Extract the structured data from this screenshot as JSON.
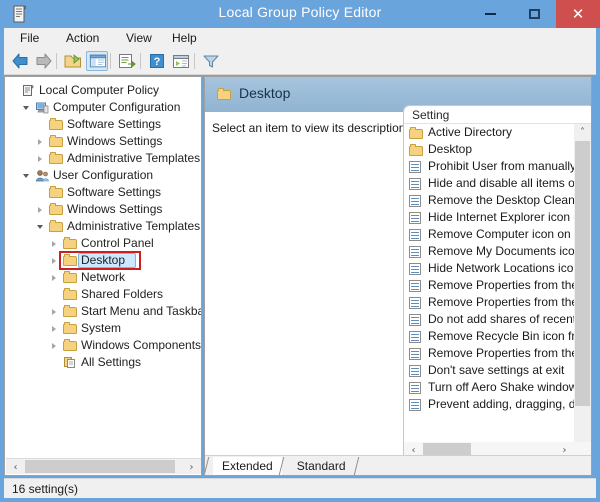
{
  "window": {
    "title": "Local Group Policy Editor",
    "icon": "policy-document-icon",
    "accent": "#6aa4dd",
    "close_color": "#cf4f4f",
    "buttons": {
      "minimize": "–",
      "maximize": "□",
      "close": "×"
    }
  },
  "menu": {
    "items": [
      "File",
      "Action",
      "View",
      "Help"
    ]
  },
  "toolbar": {
    "items": [
      {
        "name": "back-icon",
        "label": "Back"
      },
      {
        "name": "forward-icon",
        "label": "Forward"
      },
      {
        "name": "up-folder-icon",
        "label": "Up One Level"
      },
      {
        "name": "show-hide-console-tree-icon",
        "label": "Show/Hide Console Tree",
        "active": true
      },
      {
        "name": "export-list-icon",
        "label": "Export List"
      },
      {
        "name": "help-icon",
        "label": "Help"
      },
      {
        "name": "show-hide-action-pane-icon",
        "label": "Show/Hide Action Pane"
      },
      {
        "name": "filter-icon",
        "label": "Filter"
      }
    ]
  },
  "tree": {
    "nodes": [
      {
        "label": "Local Computer Policy",
        "depth": 0,
        "icon": "policy-icon",
        "twisty": "none"
      },
      {
        "label": "Computer Configuration",
        "depth": 1,
        "icon": "computer-icon",
        "twisty": "open"
      },
      {
        "label": "Software Settings",
        "depth": 2,
        "icon": "folder-icon",
        "twisty": "none"
      },
      {
        "label": "Windows Settings",
        "depth": 2,
        "icon": "folder-icon",
        "twisty": "closed"
      },
      {
        "label": "Administrative Templates",
        "depth": 2,
        "icon": "folder-icon",
        "twisty": "closed"
      },
      {
        "label": "User Configuration",
        "depth": 1,
        "icon": "user-icon",
        "twisty": "open"
      },
      {
        "label": "Software Settings",
        "depth": 2,
        "icon": "folder-icon",
        "twisty": "none"
      },
      {
        "label": "Windows Settings",
        "depth": 2,
        "icon": "folder-icon",
        "twisty": "closed"
      },
      {
        "label": "Administrative Templates",
        "depth": 2,
        "icon": "folder-icon",
        "twisty": "open"
      },
      {
        "label": "Control Panel",
        "depth": 3,
        "icon": "folder-icon",
        "twisty": "closed"
      },
      {
        "label": "Desktop",
        "depth": 3,
        "icon": "folder-icon",
        "twisty": "closed",
        "selected": true,
        "annotated": true
      },
      {
        "label": "Network",
        "depth": 3,
        "icon": "folder-icon",
        "twisty": "closed"
      },
      {
        "label": "Shared Folders",
        "depth": 3,
        "icon": "folder-icon",
        "twisty": "none"
      },
      {
        "label": "Start Menu and Taskbar",
        "depth": 3,
        "icon": "folder-icon",
        "twisty": "closed"
      },
      {
        "label": "System",
        "depth": 3,
        "icon": "folder-icon",
        "twisty": "closed"
      },
      {
        "label": "Windows Components",
        "depth": 3,
        "icon": "folder-icon",
        "twisty": "closed"
      },
      {
        "label": "All Settings",
        "depth": 3,
        "icon": "all-settings-icon",
        "twisty": "none"
      }
    ],
    "annotation_color": "#cc1f1f"
  },
  "right_pane": {
    "header_title": "Desktop",
    "header_icon": "folder-icon",
    "description": "Select an item to view its description.",
    "list": {
      "column_header": "Setting",
      "rows": [
        {
          "label": "Active Directory",
          "icon": "folder-icon"
        },
        {
          "label": "Desktop",
          "icon": "folder-icon"
        },
        {
          "label": "Prohibit User from manually re",
          "icon": "policy-setting-icon"
        },
        {
          "label": "Hide and disable all items on th",
          "icon": "policy-setting-icon"
        },
        {
          "label": "Remove the Desktop Cleanup W",
          "icon": "policy-setting-icon"
        },
        {
          "label": "Hide Internet Explorer icon on ",
          "icon": "policy-setting-icon"
        },
        {
          "label": "Remove Computer icon on the ",
          "icon": "policy-setting-icon"
        },
        {
          "label": "Remove My Documents icon o",
          "icon": "policy-setting-icon"
        },
        {
          "label": "Hide Network Locations icon o",
          "icon": "policy-setting-icon"
        },
        {
          "label": "Remove Properties from the Co",
          "icon": "policy-setting-icon"
        },
        {
          "label": "Remove Properties from the Do",
          "icon": "policy-setting-icon"
        },
        {
          "label": "Do not add shares of recently o",
          "icon": "policy-setting-icon"
        },
        {
          "label": "Remove Recycle Bin icon from",
          "icon": "policy-setting-icon"
        },
        {
          "label": "Remove Properties from the Re",
          "icon": "policy-setting-icon"
        },
        {
          "label": "Don't save settings at exit",
          "icon": "policy-setting-icon"
        },
        {
          "label": "Turn off Aero Shake window m",
          "icon": "policy-setting-icon"
        },
        {
          "label": "Prevent adding, dragging, drop",
          "icon": "policy-setting-icon"
        }
      ]
    },
    "tabs": [
      {
        "label": "Extended",
        "active": true
      },
      {
        "label": "Standard",
        "active": false
      }
    ]
  },
  "scrollbars": {
    "left_arrow": "‹",
    "right_arrow": "›",
    "up_arrow": "˄",
    "down_arrow": "˅"
  },
  "statusbar": {
    "text": "16 setting(s)"
  }
}
